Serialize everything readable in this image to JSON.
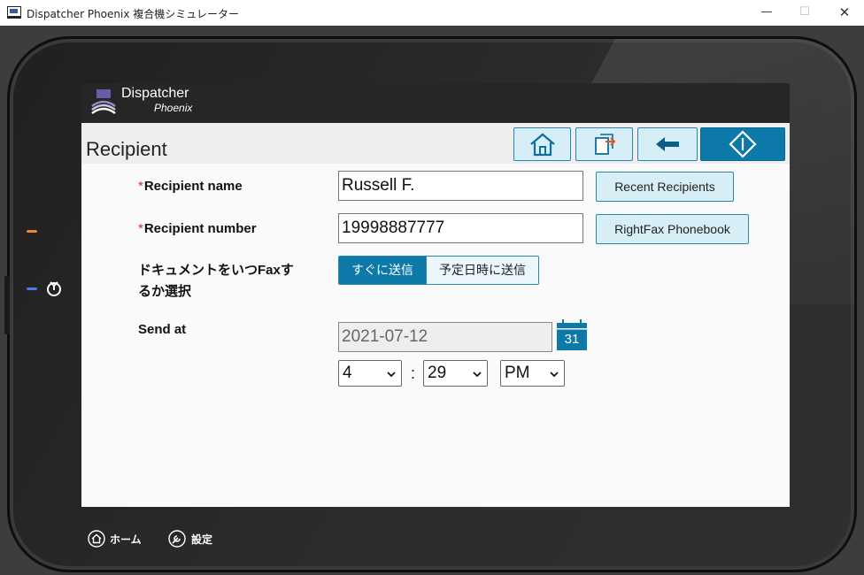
{
  "window": {
    "title": "Dispatcher Phoenix 複合機シミュレーター",
    "minimize": "—",
    "maximize": "☐",
    "close": "✕"
  },
  "brand": {
    "name": "Dispatcher",
    "sub": "Phoenix"
  },
  "page": {
    "title": "Recipient"
  },
  "form": {
    "required_mark": "*",
    "recipient_name_label": "Recipient name",
    "recipient_name_value": "Russell F.",
    "recent_recipients_button": "Recent Recipients",
    "recipient_number_label": "Recipient number",
    "recipient_number_value": "19998887777",
    "phonebook_button": "RightFax Phonebook",
    "when_label_line1": "ドキュメントをいつFaxす",
    "when_label_line2": "るか選択",
    "send_now": "すぐに送信",
    "send_scheduled": "予定日時に送信",
    "send_at_label": "Send at",
    "send_at_date": "2021-07-12",
    "calendar_day": "31",
    "hour": "4",
    "minute": "29",
    "ampm": "PM",
    "time_separator": ":"
  },
  "bottom_nav": {
    "home": "ホーム",
    "settings": "設定"
  },
  "colors": {
    "accent": "#0d79a8",
    "button_bg": "#d7eef7",
    "header_bg": "#262626",
    "required": "#c0322a"
  },
  "icons": {
    "home": "home-icon",
    "job": "job-status-icon",
    "back": "arrow-left-icon",
    "start": "start-diamond-icon",
    "calendar": "calendar-icon",
    "power": "power-icon",
    "settings": "wrench-icon"
  }
}
